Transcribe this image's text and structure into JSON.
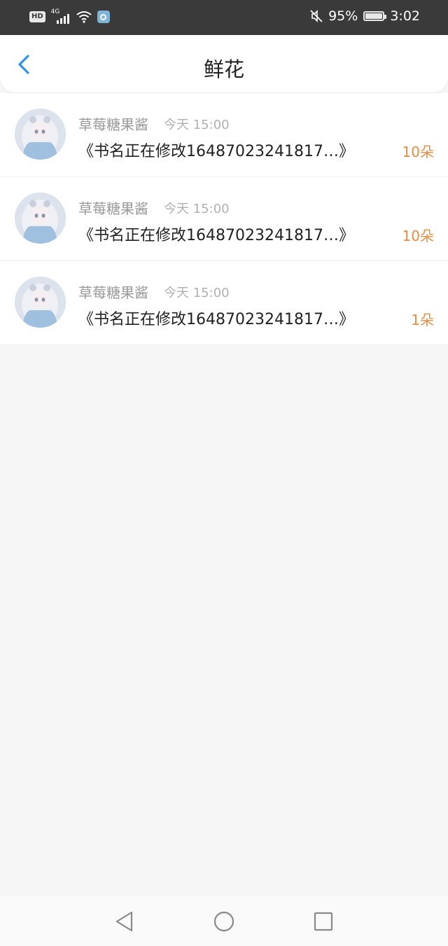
{
  "status_bar": {
    "hd": "HD",
    "network": "4G",
    "battery": "95%",
    "time": "3:02"
  },
  "header": {
    "title": "鲜花",
    "back_icon": "chevron-left-icon"
  },
  "colors": {
    "accent": "#2e95e6",
    "count": "#e98c43"
  },
  "gifts": [
    {
      "user": "草莓糖果酱",
      "time": "今天 15:00",
      "book": "《书名正在修改16487023241817…》",
      "count": "10朵"
    },
    {
      "user": "草莓糖果酱",
      "time": "今天 15:00",
      "book": "《书名正在修改16487023241817…》",
      "count": "10朵"
    },
    {
      "user": "草莓糖果酱",
      "time": "今天 15:00",
      "book": "《书名正在修改16487023241817…》",
      "count": "1朵"
    }
  ],
  "nav": {
    "back": "triangle-back-icon",
    "home": "circle-home-icon",
    "recents": "square-recents-icon"
  }
}
